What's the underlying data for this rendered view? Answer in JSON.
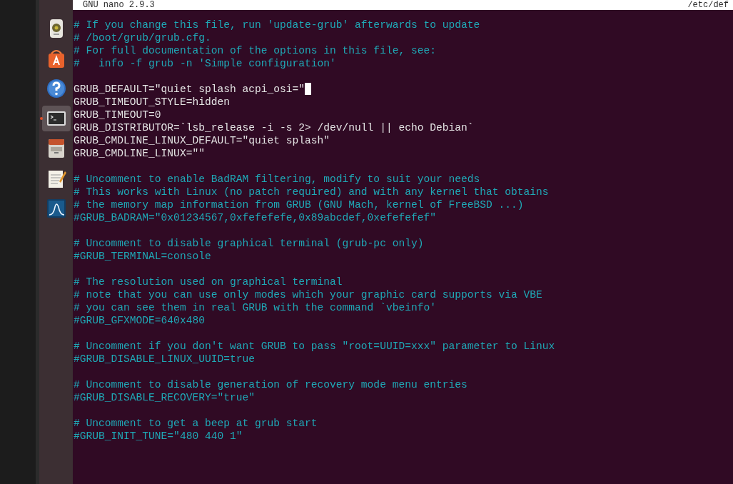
{
  "launcher": {
    "items": [
      {
        "kind": "speaker",
        "selected": false,
        "running": false
      },
      {
        "kind": "software",
        "selected": false,
        "running": false
      },
      {
        "kind": "help",
        "selected": false,
        "running": false
      },
      {
        "kind": "terminal",
        "selected": true,
        "running": true
      },
      {
        "kind": "files",
        "selected": false,
        "running": false
      },
      {
        "kind": "editor",
        "selected": false,
        "running": false
      },
      {
        "kind": "monitor",
        "selected": false,
        "running": false
      }
    ]
  },
  "editor": {
    "title": "GNU nano 2.9.3",
    "path": "/etc/def",
    "blocks": [
      [
        {
          "kind": "comment",
          "text": "# If you change this file, run 'update-grub' afterwards to update",
          "cursor": false
        },
        {
          "kind": "comment",
          "text": "# /boot/grub/grub.cfg.",
          "cursor": false
        },
        {
          "kind": "comment",
          "text": "# For full documentation of the options in this file, see:",
          "cursor": false
        },
        {
          "kind": "comment",
          "text": "#   info -f grub -n 'Simple configuration'",
          "cursor": false
        }
      ],
      [
        {
          "kind": "setting",
          "text": "GRUB_DEFAULT=\"quiet splash acpi_osi=\"",
          "cursor": true
        },
        {
          "kind": "setting",
          "text": "GRUB_TIMEOUT_STYLE=hidden",
          "cursor": false
        },
        {
          "kind": "setting",
          "text": "GRUB_TIMEOUT=0",
          "cursor": false
        },
        {
          "kind": "setting",
          "text": "GRUB_DISTRIBUTOR=`lsb_release -i -s 2> /dev/null || echo Debian`",
          "cursor": false
        },
        {
          "kind": "setting",
          "text": "GRUB_CMDLINE_LINUX_DEFAULT=\"quiet splash\"",
          "cursor": false
        },
        {
          "kind": "setting",
          "text": "GRUB_CMDLINE_LINUX=\"\"",
          "cursor": false
        }
      ],
      [
        {
          "kind": "comment",
          "text": "# Uncomment to enable BadRAM filtering, modify to suit your needs",
          "cursor": false
        },
        {
          "kind": "comment",
          "text": "# This works with Linux (no patch required) and with any kernel that obtains",
          "cursor": false
        },
        {
          "kind": "comment",
          "text": "# the memory map information from GRUB (GNU Mach, kernel of FreeBSD ...)",
          "cursor": false
        },
        {
          "kind": "comment",
          "text": "#GRUB_BADRAM=\"0x01234567,0xfefefefe,0x89abcdef,0xefefefef\"",
          "cursor": false
        }
      ],
      [
        {
          "kind": "comment",
          "text": "# Uncomment to disable graphical terminal (grub-pc only)",
          "cursor": false
        },
        {
          "kind": "comment",
          "text": "#GRUB_TERMINAL=console",
          "cursor": false
        }
      ],
      [
        {
          "kind": "comment",
          "text": "# The resolution used on graphical terminal",
          "cursor": false
        },
        {
          "kind": "comment",
          "text": "# note that you can use only modes which your graphic card supports via VBE",
          "cursor": false
        },
        {
          "kind": "comment",
          "text": "# you can see them in real GRUB with the command `vbeinfo'",
          "cursor": false
        },
        {
          "kind": "comment",
          "text": "#GRUB_GFXMODE=640x480",
          "cursor": false
        }
      ],
      [
        {
          "kind": "comment",
          "text": "# Uncomment if you don't want GRUB to pass \"root=UUID=xxx\" parameter to Linux",
          "cursor": false
        },
        {
          "kind": "comment",
          "text": "#GRUB_DISABLE_LINUX_UUID=true",
          "cursor": false
        }
      ],
      [
        {
          "kind": "comment",
          "text": "# Uncomment to disable generation of recovery mode menu entries",
          "cursor": false
        },
        {
          "kind": "comment",
          "text": "#GRUB_DISABLE_RECOVERY=\"true\"",
          "cursor": false
        }
      ],
      [
        {
          "kind": "comment",
          "text": "# Uncomment to get a beep at grub start",
          "cursor": false
        },
        {
          "kind": "comment",
          "text": "#GRUB_INIT_TUNE=\"480 440 1\"",
          "cursor": false
        }
      ]
    ]
  }
}
